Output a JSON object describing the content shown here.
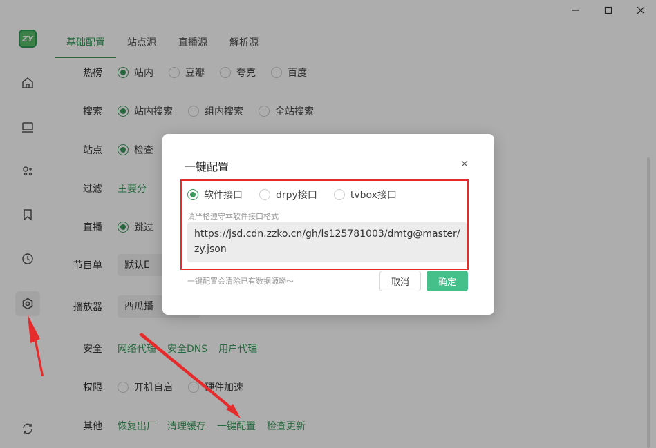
{
  "window": {
    "minimize_icon": "minimize-icon",
    "maximize_icon": "maximize-icon",
    "close_icon": "close-icon"
  },
  "sidebar": {
    "logo_text": "ZY",
    "items": [
      {
        "icon": "home-icon"
      },
      {
        "icon": "monitor-icon"
      },
      {
        "icon": "apps-icon"
      },
      {
        "icon": "bookmark-icon"
      },
      {
        "icon": "history-icon"
      },
      {
        "icon": "settings-icon",
        "active": true
      }
    ],
    "bottom_icon": "sync-icon"
  },
  "tabs": [
    {
      "label": "基础配置",
      "active": true
    },
    {
      "label": "站点源"
    },
    {
      "label": "直播源"
    },
    {
      "label": "解析源"
    }
  ],
  "settings": {
    "hot": {
      "label": "热榜",
      "options": [
        "站内",
        "豆瓣",
        "夸克",
        "百度"
      ],
      "selected": 0
    },
    "search": {
      "label": "搜索",
      "options": [
        "站内搜索",
        "组内搜索",
        "全站搜索"
      ],
      "selected": 0
    },
    "site": {
      "label": "站点",
      "visible_option": "检查"
    },
    "filter": {
      "label": "过滤",
      "visible_link": "主要分"
    },
    "live": {
      "label": "直播",
      "visible_option": "跳过"
    },
    "epg": {
      "label": "节目单",
      "value": "默认E"
    },
    "player": {
      "label": "播放器",
      "value": "西瓜播"
    },
    "security": {
      "label": "安全",
      "links": [
        "网络代理",
        "安全DNS",
        "用户代理"
      ]
    },
    "permission": {
      "label": "权限",
      "options": [
        "开机自启",
        "硬件加速"
      ]
    },
    "other": {
      "label": "其他",
      "links": [
        "恢复出厂",
        "清理缓存",
        "一键配置",
        "检查更新"
      ]
    }
  },
  "dialog": {
    "title": "一键配置",
    "radio_options": [
      "软件接口",
      "drpy接口",
      "tvbox接口"
    ],
    "selected": 0,
    "hint": "请严格遵守本软件接口格式",
    "url_value": "https://jsd.cdn.zzko.cn/gh/ls125781003/dmtg@master/zy.json",
    "note": "一键配置会清除已有数据源呦～",
    "cancel_label": "取消",
    "confirm_label": "确定"
  },
  "colors": {
    "accent": "#3a9a5c",
    "confirm": "#46c08a",
    "annotation": "#e52b2b"
  }
}
